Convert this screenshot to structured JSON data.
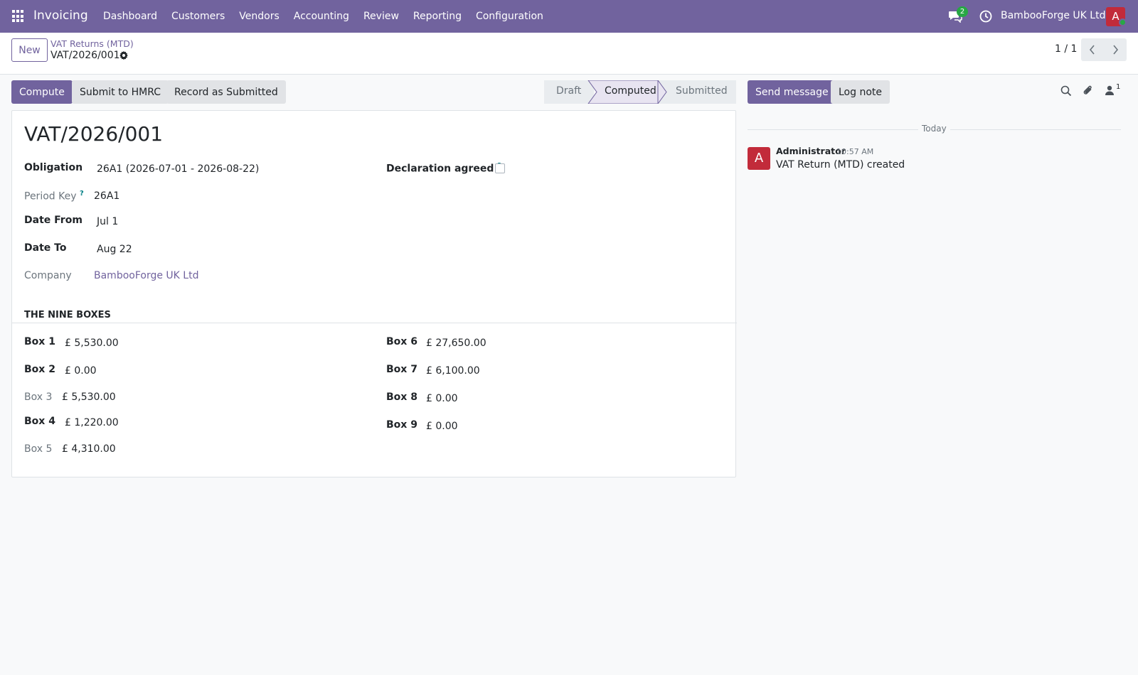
{
  "navbar": {
    "app_name": "Invoicing",
    "menu": [
      "Dashboard",
      "Customers",
      "Vendors",
      "Accounting",
      "Review",
      "Reporting",
      "Configuration"
    ],
    "chat_count": "2",
    "company": "BambooForge UK Ltd",
    "avatar_letter": "A"
  },
  "control_panel": {
    "new_label": "New",
    "breadcrumb": "VAT Returns (MTD)",
    "record_name": "VAT/2026/001",
    "pager": "1 / 1"
  },
  "actions": {
    "compute": "Compute",
    "submit": "Submit to HMRC",
    "record_submitted": "Record as Submitted"
  },
  "status": {
    "steps": [
      "Draft",
      "Computed",
      "Submitted"
    ],
    "active": "Computed"
  },
  "form": {
    "title": "VAT/2026/001",
    "obligation_label": "Obligation",
    "obligation_value": "26A1 (2026-07-01 - 2026-08-22)",
    "period_key_label": "Period Key",
    "period_key_value": "26A1",
    "date_from_label": "Date From",
    "date_from_value": "Jul 1",
    "date_to_label": "Date To",
    "date_to_value": "Aug 22",
    "company_label": "Company",
    "company_value": "BambooForge UK Ltd",
    "declaration_label": "Declaration agreed",
    "declaration_checked": false,
    "help_mark": "?",
    "section_title": "THE NINE BOXES",
    "boxes": [
      {
        "label": "Box 1",
        "value": "£ 5,530.00"
      },
      {
        "label": "Box 2",
        "value": "£ 0.00"
      },
      {
        "label": "Box 3",
        "value": "£ 5,530.00"
      },
      {
        "label": "Box 4",
        "value": "£ 1,220.00"
      },
      {
        "label": "Box 5",
        "value": "£ 4,310.00"
      },
      {
        "label": "Box 6",
        "value": "£ 27,650.00"
      },
      {
        "label": "Box 7",
        "value": "£ 6,100.00"
      },
      {
        "label": "Box 8",
        "value": "£ 0.00"
      },
      {
        "label": "Box 9",
        "value": "£ 0.00"
      }
    ]
  },
  "chatter": {
    "send_message": "Send message",
    "log_note": "Log note",
    "followers_count": "1",
    "day_separator": "Today",
    "messages": [
      {
        "avatar": "A",
        "author": "Administrator",
        "time": "10:57 AM",
        "body": "VAT Return (MTD) created"
      }
    ]
  },
  "colors": {
    "brand": "#71639e",
    "avatar": "#c22b3a",
    "online": "#28a745"
  }
}
